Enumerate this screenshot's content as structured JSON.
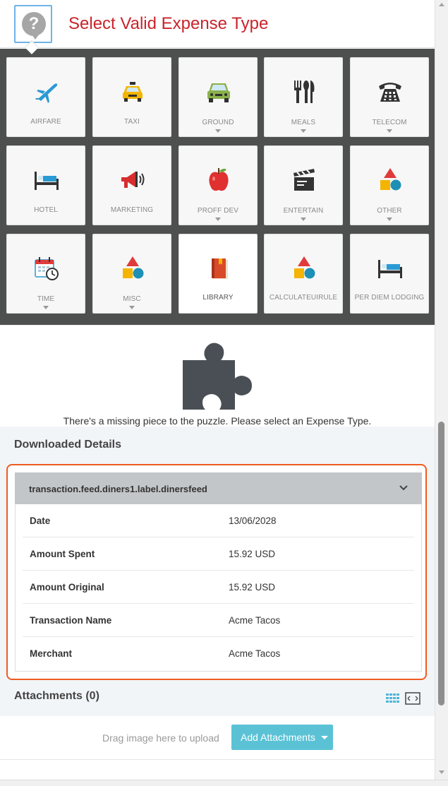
{
  "header": {
    "title": "Select Valid Expense Type",
    "help_glyph": "?"
  },
  "expense_types": [
    {
      "label": "AIRFARE",
      "icon": "airplane-icon",
      "dropdown": false
    },
    {
      "label": "TAXI",
      "icon": "taxi-icon",
      "dropdown": false
    },
    {
      "label": "GROUND",
      "icon": "car-icon",
      "dropdown": true
    },
    {
      "label": "MEALS",
      "icon": "fork-knife-icon",
      "dropdown": true
    },
    {
      "label": "TELECOM",
      "icon": "telephone-icon",
      "dropdown": true
    },
    {
      "label": "HOTEL",
      "icon": "bed-icon",
      "dropdown": false
    },
    {
      "label": "MARKETING",
      "icon": "megaphone-icon",
      "dropdown": false
    },
    {
      "label": "PROFF DEV",
      "icon": "apple-icon",
      "dropdown": true
    },
    {
      "label": "ENTERTAIN",
      "icon": "clapperboard-icon",
      "dropdown": true
    },
    {
      "label": "OTHER",
      "icon": "shapes-icon",
      "dropdown": true
    },
    {
      "label": "TIME",
      "icon": "calendar-clock-icon",
      "dropdown": true
    },
    {
      "label": "MISC",
      "icon": "shapes-icon",
      "dropdown": true
    },
    {
      "label": "LIBRARY",
      "icon": "book-icon",
      "dropdown": false
    },
    {
      "label": "CALCULATEUIRULE",
      "icon": "shapes-icon",
      "dropdown": false
    },
    {
      "label": "PER DIEM LODGING",
      "icon": "bed-icon",
      "dropdown": false
    }
  ],
  "puzzle": {
    "message": "There's a missing piece to the puzzle. Please select an Expense Type."
  },
  "downloaded": {
    "title": "Downloaded Details",
    "panel_title": "transaction.feed.diners1.label.dinersfeed",
    "rows": [
      {
        "key": "Date",
        "value": "13/06/2028"
      },
      {
        "key": "Amount Spent",
        "value": "15.92 USD"
      },
      {
        "key": "Amount Original",
        "value": "15.92 USD"
      },
      {
        "key": "Transaction Name",
        "value": "Acme Tacos"
      },
      {
        "key": "Merchant",
        "value": "Acme Tacos"
      }
    ]
  },
  "attachments": {
    "title": "Attachments  (0)",
    "drag_text": "Drag image here to upload",
    "add_button": "Add Attachments"
  },
  "colors": {
    "title": "#c8242c",
    "highlight": "#ee5b1f",
    "button": "#5bc2d6",
    "grid_bg": "#4e4f4f"
  }
}
